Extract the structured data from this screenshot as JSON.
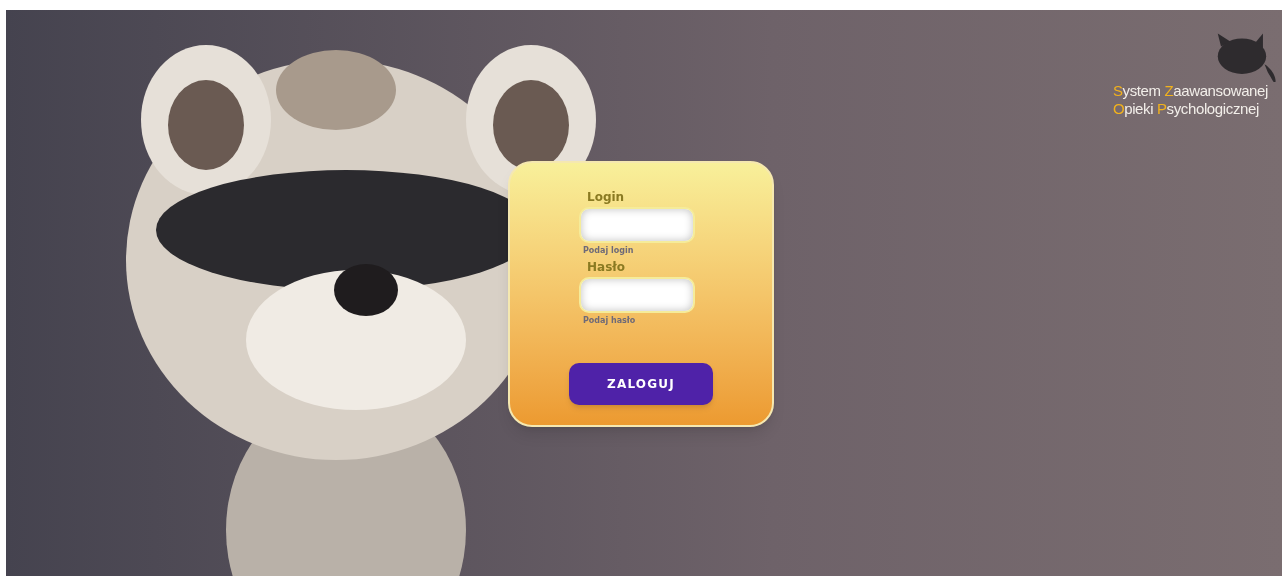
{
  "logo": {
    "lines": [
      "System Zaawansowanej",
      "Opieki Psychologicznej"
    ]
  },
  "form": {
    "fields": [
      {
        "label": "Login",
        "hint": "Podaj login"
      },
      {
        "label": "Hasło",
        "hint": "Podaj hasło"
      }
    ],
    "submit": "ZALOGUJ"
  }
}
